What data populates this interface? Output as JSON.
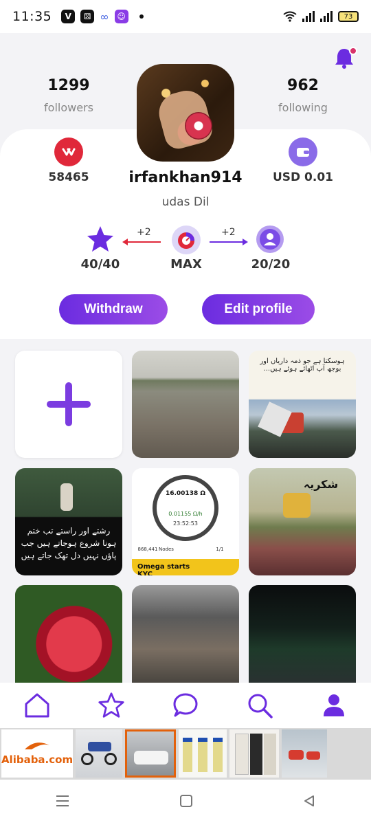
{
  "status_bar": {
    "time": "11:35",
    "battery": "73"
  },
  "profile": {
    "followers_count": "1299",
    "followers_label": "followers",
    "following_count": "962",
    "following_label": "following",
    "likes_value": "58465",
    "wallet_value": "USD 0.01",
    "username": "irfankhan914",
    "bio": "udas Dil"
  },
  "levels": {
    "left_value": "40/40",
    "left_delta": "+2",
    "center_label": "MAX",
    "right_delta": "+2",
    "right_value": "20/20"
  },
  "actions": {
    "withdraw_label": "Withdraw",
    "edit_profile_label": "Edit profile"
  },
  "posts": {
    "urdu_text_1": "ہوسکتا ہے جو ذمہ داریاں اور بوجھ آپ اٹھائے ہوئے ہیں...",
    "urdu_text_2": "رشتے اور راستے تب ختم ہونا شروع ہوجاتے ہیں جب پاؤں نہیں دل تھک جاتے ہیں",
    "crypto_balance": "16.00138 Ω",
    "crypto_rate": "0.01155 Ω/h",
    "crypto_timer": "23:52:53",
    "crypto_nodes": "868,441",
    "crypto_nodes_label": "Nodes",
    "crypto_page": "1/1",
    "crypto_banner": "Omega starts KYC",
    "urdu_text_3": "شکریہ"
  },
  "ads": {
    "logo_text": "Alibaba.com"
  },
  "colors": {
    "accent": "#6b2ce0",
    "accent_light": "#9b4ce6",
    "likes_red": "#e0283a",
    "bell_dot": "#d9336b"
  },
  "icons": {
    "bell": "bell-icon",
    "likes": "heart-badge-icon",
    "wallet": "wallet-icon",
    "star": "star-icon",
    "timer": "stopwatch-icon",
    "user": "user-icon",
    "add": "plus-icon",
    "home": "home-icon",
    "favorites": "star-outline-icon",
    "chat": "chat-icon",
    "search": "search-icon",
    "profile": "profile-icon"
  }
}
